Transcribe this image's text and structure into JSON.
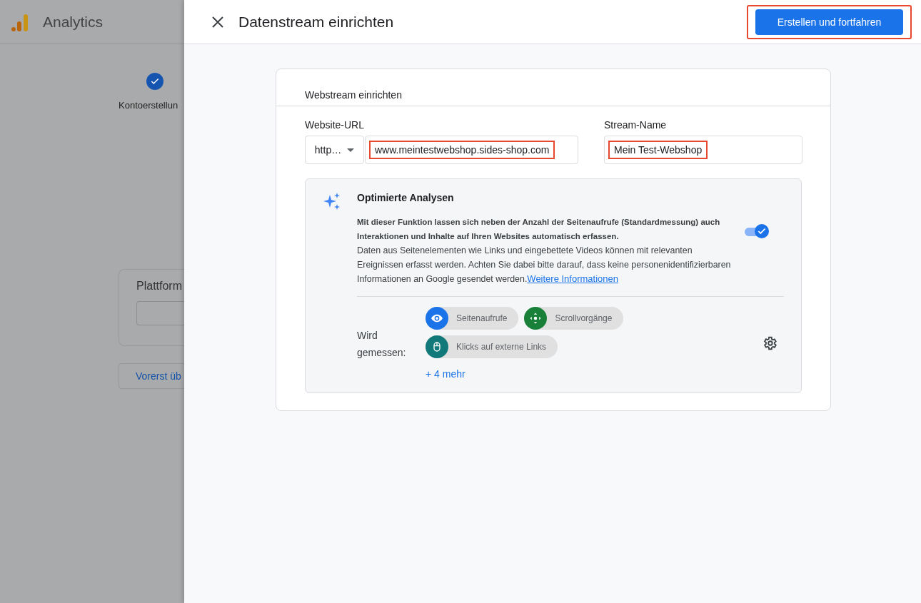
{
  "background": {
    "app_name": "Analytics",
    "step": {
      "label": "Kontoerstellun",
      "completed": true
    },
    "platform_card": {
      "title": "Plattform"
    },
    "skip_button": "Vorerst üb"
  },
  "dialog": {
    "title": "Datenstream einrichten",
    "primary_button": {
      "label": "Erstellen und fortfahren",
      "highlighted": true
    },
    "card": {
      "title": "Webstream einrichten",
      "url_field": {
        "label": "Website-URL",
        "protocol": "http…",
        "value": "www.meintestwebshop.sides-shop.com",
        "highlighted": true
      },
      "name_field": {
        "label": "Stream-Name",
        "value": "Mein Test-Webshop",
        "highlighted": true
      },
      "enhanced": {
        "title": "Optimierte Analysen",
        "description_bold": "Mit dieser Funktion lassen sich neben der Anzahl der Seitenaufrufe (Standardmessung) auch Interaktionen und Inhalte auf Ihren Websites automatisch erfassen.",
        "description": "Daten aus Seitenelementen wie Links und eingebettete Videos können mit relevanten Ereignissen erfasst werden. Achten Sie dabei bitte darauf, dass keine personenidentifizierbaren Informationen an Google gesendet werden.",
        "link": "Weitere Informationen",
        "on": true,
        "measured_label": "Wird gemessen:",
        "chips": [
          {
            "label": "Seitenaufrufe",
            "kind": "eye",
            "color": "#1a73e8"
          },
          {
            "label": "Scrollvorgänge",
            "kind": "scroll",
            "color": "#188038"
          },
          {
            "label": "Klicks auf externe Links",
            "kind": "mouse",
            "color": "#12797a"
          }
        ],
        "more": "+ 4 mehr"
      }
    }
  }
}
